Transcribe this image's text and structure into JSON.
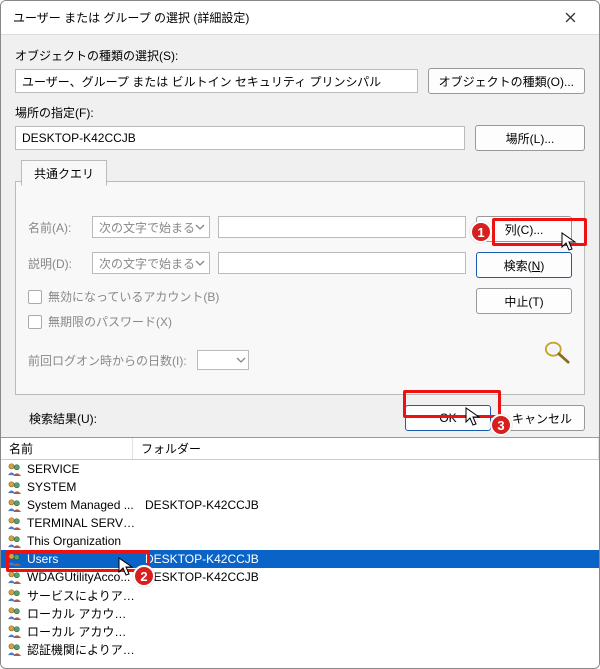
{
  "window": {
    "title": "ユーザー または グループ の選択 (詳細設定)"
  },
  "sections": {
    "object_type_label": "オブジェクトの種類の選択(S):",
    "object_type_value": "ユーザー、グループ または ビルトイン セキュリティ プリンシパル",
    "object_type_button": "オブジェクトの種類(O)...",
    "location_label": "場所の指定(F):",
    "location_value": "DESKTOP-K42CCJB",
    "location_button": "場所(L)..."
  },
  "query": {
    "tab_label": "共通クエリ",
    "name_label": "名前(A):",
    "name_combo": "次の文字で始まる",
    "desc_label": "説明(D):",
    "desc_combo": "次の文字で始まる",
    "chk_disabled": "無効になっているアカウント(B)",
    "chk_nonexp": "無期限のパスワード(X)",
    "days_label": "前回ログオン時からの日数(I):",
    "columns_btn": "列(C)...",
    "search_btn_pre": "検索(",
    "search_btn_und": "N",
    "search_btn_post": ")",
    "stop_btn": "中止(T)"
  },
  "buttons": {
    "ok": "OK",
    "cancel": "キャンセル"
  },
  "results": {
    "label": "検索結果(U):",
    "col_name": "名前",
    "col_folder": "フォルダー",
    "rows": [
      {
        "name": "SERVICE",
        "folder": ""
      },
      {
        "name": "SYSTEM",
        "folder": ""
      },
      {
        "name": "System Managed ...",
        "folder": "DESKTOP-K42CCJB"
      },
      {
        "name": "TERMINAL SERVE...",
        "folder": ""
      },
      {
        "name": "This Organization",
        "folder": ""
      },
      {
        "name": "Users",
        "folder": "DESKTOP-K42CCJB",
        "selected": true
      },
      {
        "name": "WDAGUtilityAcco...",
        "folder": "DESKTOP-K42CCJB"
      },
      {
        "name": "サービスによりアサ...",
        "folder": ""
      },
      {
        "name": "ローカル アカウント",
        "folder": ""
      },
      {
        "name": "ローカル アカウントと ...",
        "folder": ""
      },
      {
        "name": "認証機関によりアサ...",
        "folder": ""
      }
    ]
  },
  "annotations": {
    "b1": "1",
    "b2": "2",
    "b3": "3"
  }
}
